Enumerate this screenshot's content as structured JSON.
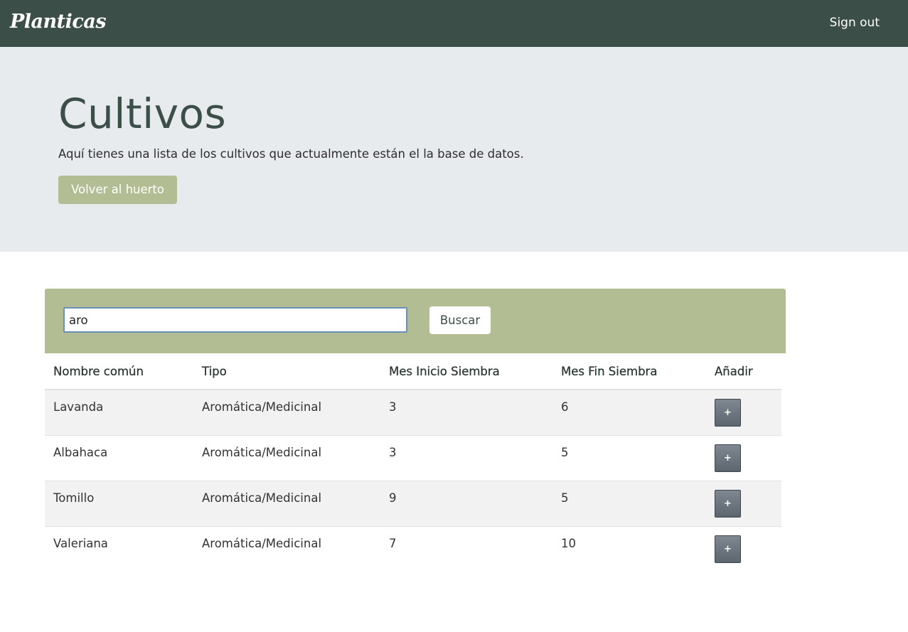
{
  "navbar": {
    "brand": "Planticas",
    "signout_label": "Sign out"
  },
  "hero": {
    "title": "Cultivos",
    "subtitle": "Aquí tienes una lista de los cultivos que actualmente están el la base de datos.",
    "back_button_label": "Volver al huerto"
  },
  "search": {
    "value": "aro",
    "button_label": "Buscar"
  },
  "table": {
    "headers": [
      "Nombre común",
      "Tipo",
      "Mes Inicio Siembra",
      "Mes Fin Siembra",
      "Añadir"
    ],
    "rows": [
      {
        "name": "Lavanda",
        "type": "Aromática/Medicinal",
        "start": "3",
        "end": "6",
        "add": "+"
      },
      {
        "name": "Albahaca",
        "type": "Aromática/Medicinal",
        "start": "3",
        "end": "5",
        "add": "+"
      },
      {
        "name": "Tomillo",
        "type": "Aromática/Medicinal",
        "start": "9",
        "end": "5",
        "add": "+"
      },
      {
        "name": "Valeriana",
        "type": "Aromática/Medicinal",
        "start": "7",
        "end": "10",
        "add": "+"
      }
    ]
  },
  "colors": {
    "navbar": "#3b4e47",
    "hero_background": "#e8ebee",
    "accent": "#b3bd94",
    "stripe": "#f2f2f2"
  }
}
